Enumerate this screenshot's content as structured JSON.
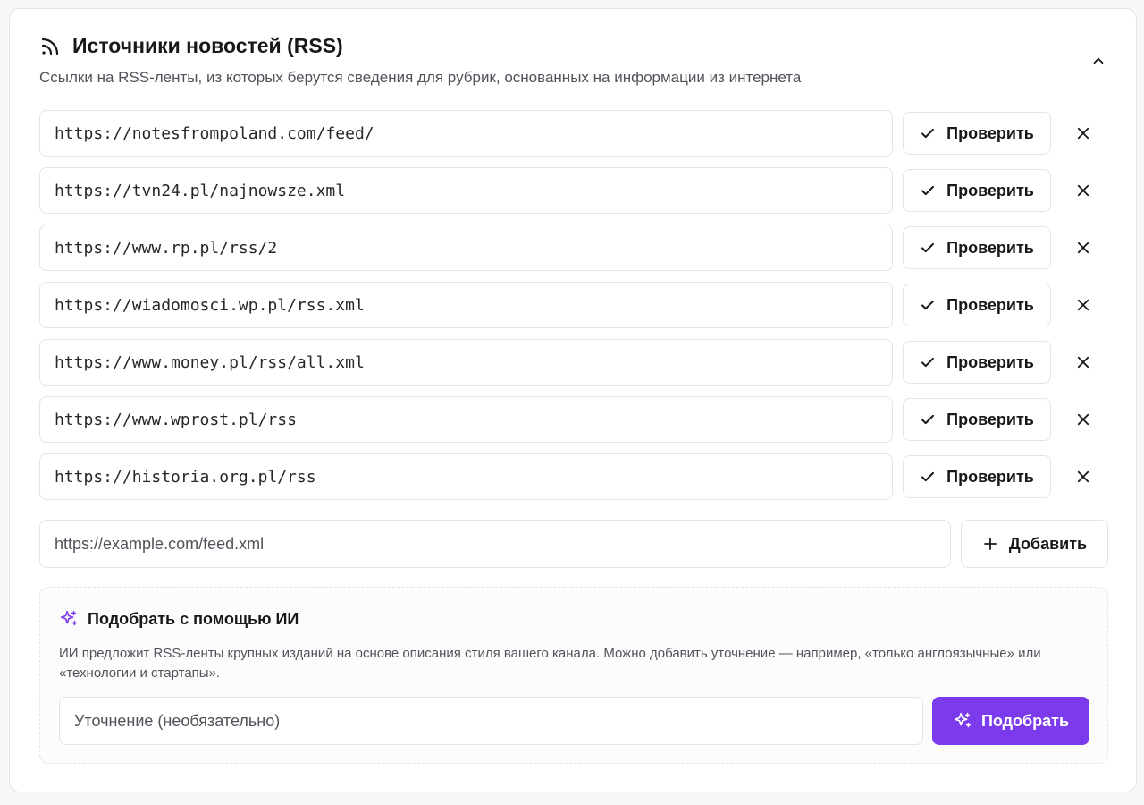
{
  "section": {
    "title": "Источники новостей (RSS)",
    "subtitle": "Ссылки на RSS-ленты, из которых берутся сведения для рубрик, основанных на информации из интернета"
  },
  "feeds": [
    {
      "url": "https://notesfrompoland.com/feed/",
      "check_label": "Проверить"
    },
    {
      "url": "https://tvn24.pl/najnowsze.xml",
      "check_label": "Проверить"
    },
    {
      "url": "https://www.rp.pl/rss/2",
      "check_label": "Проверить"
    },
    {
      "url": "https://wiadomosci.wp.pl/rss.xml",
      "check_label": "Проверить"
    },
    {
      "url": "https://www.money.pl/rss/all.xml",
      "check_label": "Проверить"
    },
    {
      "url": "https://www.wprost.pl/rss",
      "check_label": "Проверить"
    },
    {
      "url": "https://historia.org.pl/rss",
      "check_label": "Проверить"
    }
  ],
  "add": {
    "placeholder": "https://example.com/feed.xml",
    "button_label": "Добавить"
  },
  "ai": {
    "title": "Подобрать с помощью ИИ",
    "description": "ИИ предложит RSS-ленты крупных изданий на основе описания стиля вашего канала. Можно добавить уточнение — например, «только англоязычные» или «технологии и стартапы».",
    "placeholder": "Уточнение (необязательно)",
    "button_label": "Подобрать"
  },
  "colors": {
    "accent": "#7c3aed",
    "border": "#e4e4e7",
    "muted_text": "#52525b"
  },
  "icons": {
    "header": "rss-icon",
    "collapse": "chevron-up-icon",
    "check": "check-icon",
    "remove": "close-icon",
    "add": "plus-icon",
    "ai": "sparkles-icon"
  }
}
